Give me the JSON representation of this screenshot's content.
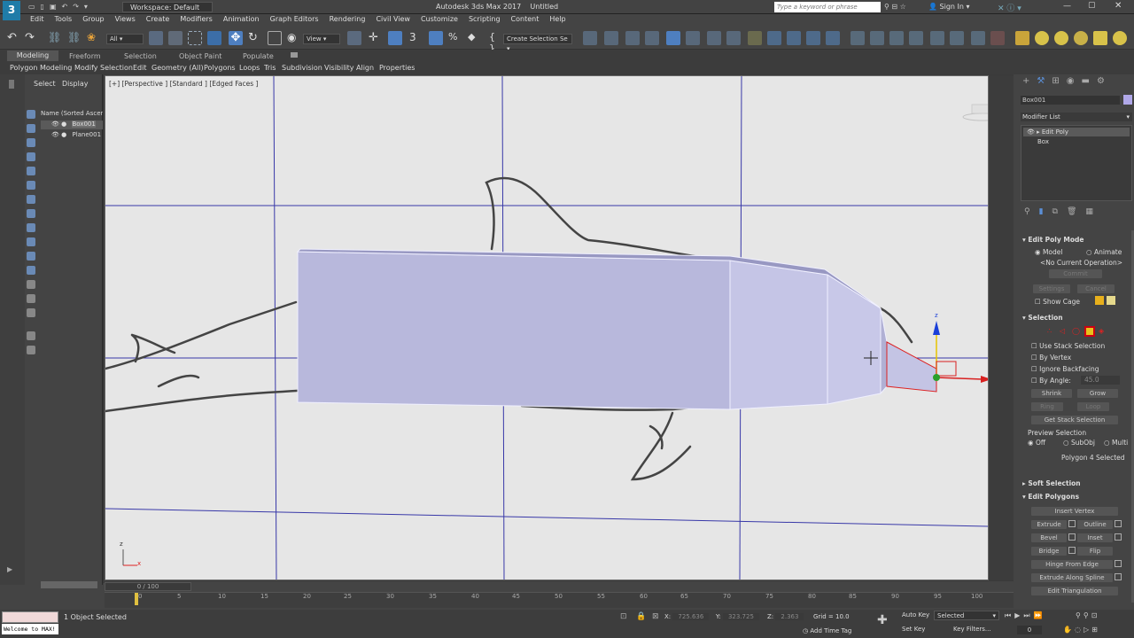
{
  "titlebar": {
    "app_title": "Autodesk 3ds Max 2017",
    "doc_title": "Untitled",
    "workspace": "Workspace: Default",
    "search_placeholder": "Type a keyword or phrase",
    "sign_in": "Sign In"
  },
  "menu": [
    "Edit",
    "Tools",
    "Group",
    "Views",
    "Create",
    "Modifiers",
    "Animation",
    "Graph Editors",
    "Rendering",
    "Civil View",
    "Customize",
    "Scripting",
    "Content",
    "Help"
  ],
  "toolbar": {
    "filter": "All",
    "view_dropdown": "View",
    "selection_set": "Create Selection Se"
  },
  "ribbon": {
    "tabs": [
      "Modeling",
      "Freeform",
      "Selection",
      "Object Paint",
      "Populate"
    ],
    "subtabs": [
      "Polygon Modeling",
      "Modify Selection",
      "Edit",
      "Geometry (All)",
      "Polygons",
      "Loops",
      "Tris",
      "Subdivision",
      "Visibility",
      "Align",
      "Properties"
    ]
  },
  "scene": {
    "tabs": [
      "Select",
      "Display"
    ],
    "header": "Name (Sorted Ascen",
    "objects": [
      "Box001",
      "Plane001"
    ]
  },
  "viewport": {
    "label": "[+] [Perspective ] [Standard ] [Edged Faces ]",
    "gizmo_z": "z",
    "gizmo_x": "x"
  },
  "command_panel": {
    "object_name": "Box001",
    "modifier_list": "Modifier List",
    "stack": [
      "Edit Poly",
      "Box"
    ],
    "edit_poly_mode": {
      "title": "Edit Poly Mode",
      "model": "Model",
      "animate": "Animate",
      "no_op": "<No Current Operation>",
      "commit": "Commit",
      "settings": "Settings",
      "cancel": "Cancel",
      "show_cage": "Show Cage"
    },
    "selection": {
      "title": "Selection",
      "use_stack": "Use Stack Selection",
      "by_vertex": "By Vertex",
      "ignore_backfacing": "Ignore Backfacing",
      "by_angle": "By Angle:",
      "angle_value": "45.0",
      "shrink": "Shrink",
      "grow": "Grow",
      "ring": "Ring",
      "loop": "Loop",
      "get_stack": "Get Stack Selection",
      "preview": "Preview Selection",
      "off": "Off",
      "subobj": "SubObj",
      "multi": "Multi",
      "status": "Polygon 4 Selected"
    },
    "soft_selection": "Soft Selection",
    "edit_polygons": {
      "title": "Edit Polygons",
      "insert_vertex": "Insert Vertex",
      "extrude": "Extrude",
      "outline": "Outline",
      "bevel": "Bevel",
      "inset": "Inset",
      "bridge": "Bridge",
      "flip": "Flip",
      "hinge": "Hinge From Edge",
      "extrude_spline": "Extrude Along Spline",
      "edit_tri": "Edit Triangulation"
    }
  },
  "timeline": {
    "frame": "0 / 100",
    "ticks": [
      "0",
      "5",
      "10",
      "15",
      "20",
      "25",
      "30",
      "35",
      "40",
      "45",
      "50",
      "55",
      "60",
      "65",
      "70",
      "75",
      "80",
      "85",
      "90",
      "95",
      "100"
    ]
  },
  "status": {
    "maxscript": "Welcome to MAX!",
    "selected": "1 Object Selected",
    "x_label": "X:",
    "x_value": "725.636",
    "y_label": "Y:",
    "y_value": "323.725",
    "z_label": "Z:",
    "z_value": "2.363",
    "grid": "Grid = 10.0",
    "add_time_tag": "Add Time Tag",
    "auto_key": "Auto Key",
    "selected_dd": "Selected",
    "set_key": "Set Key",
    "key_filters": "Key Filters...",
    "frame_value": "0"
  },
  "colors": {
    "bg": "#444444",
    "viewport": "#e6e6e6",
    "box": "#b7b7dc",
    "accent": "#5b8fd6"
  }
}
